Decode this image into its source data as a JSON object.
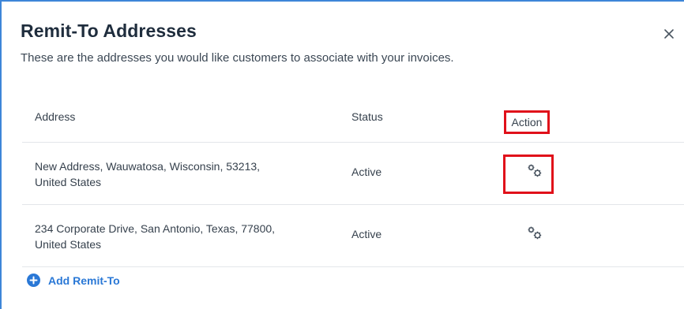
{
  "modal": {
    "title": "Remit-To Addresses",
    "subtitle": "These are the addresses you would like customers to associate with your invoices.",
    "close_icon": "close-icon"
  },
  "table": {
    "headers": {
      "address": "Address",
      "status": "Status",
      "action": "Action"
    },
    "rows": [
      {
        "address_line1": "New Address, Wauwatosa, Wisconsin, 53213,",
        "address_line2": "United States",
        "status": "Active",
        "action_icon": "gears-icon"
      },
      {
        "address_line1": "234 Corporate Drive, San Antonio, Texas, 77800,",
        "address_line2": "United States",
        "status": "Active",
        "action_icon": "gears-icon"
      }
    ]
  },
  "footer": {
    "add_label": "Add Remit-To",
    "add_icon": "plus-circle-icon"
  },
  "colors": {
    "accent": "#2a78d6",
    "frame_border": "#3d86d8",
    "highlight": "#e0101a",
    "text": "#36414d"
  }
}
